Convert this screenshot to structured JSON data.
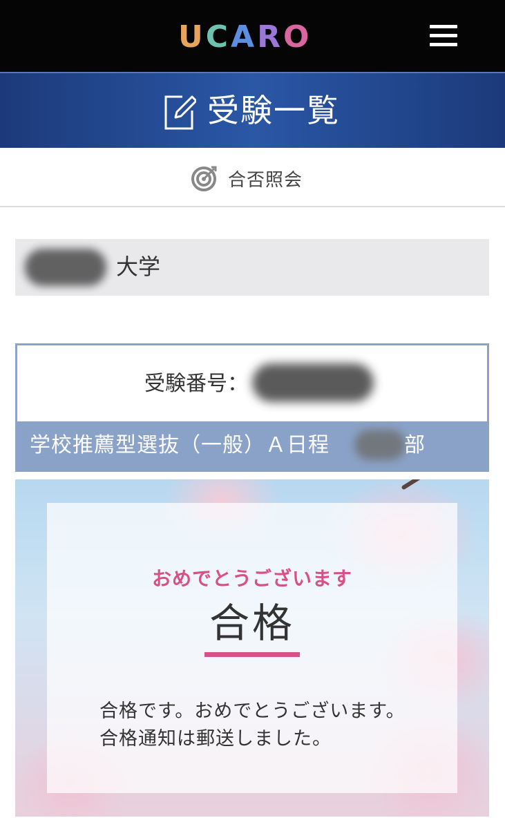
{
  "header": {
    "logo_letters": [
      "U",
      "C",
      "A",
      "R",
      "O"
    ],
    "logo_colors": [
      "#e8a35c",
      "#6ec3b0",
      "#5e8ee0",
      "#9b78d8",
      "#d867a0"
    ],
    "menu_icon": "hamburger-menu-icon"
  },
  "title_bar": {
    "icon": "edit-note-icon",
    "title": "受験一覧"
  },
  "subtab": {
    "icon": "target-icon",
    "label": "合否照会"
  },
  "university": {
    "name_suffix": "大学"
  },
  "exam": {
    "number_label": "受験番号：",
    "type_text": "学校推薦型選抜（一般）Ａ日程",
    "dept_suffix": "部"
  },
  "result": {
    "congrats": "おめでとうございます",
    "verdict": "合格",
    "message": "合格です。おめでとうございます。合格通知は郵送しました。",
    "accent_color": "#d94f88"
  }
}
